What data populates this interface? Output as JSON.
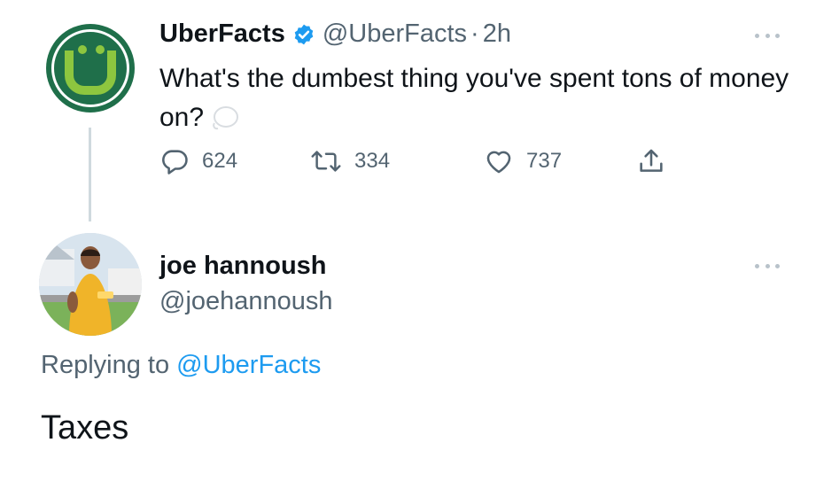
{
  "tweet": {
    "author_name": "UberFacts",
    "handle": "@UberFacts",
    "separator": "·",
    "time": "2h",
    "text": "What's the dumbest thing you've spent tons of money on?",
    "verified_icon": "verified-badge-icon",
    "emoji": "thinking-face-emoji",
    "stats": {
      "replies": "624",
      "retweets": "334",
      "likes": "737"
    }
  },
  "reply": {
    "author_name": "joe hannoush",
    "handle": "@joehannoush",
    "replying_to_label": "Replying to",
    "replying_to_handle": "@UberFacts",
    "text": "Taxes"
  },
  "colors": {
    "text_primary": "#0f1419",
    "text_secondary": "#536471",
    "link": "#1d9bf0",
    "verified": "#1d9bf0",
    "avatar_bg": "#1f6f4a",
    "avatar_accent": "#8dc63f",
    "thread_line": "#cfd9de"
  }
}
